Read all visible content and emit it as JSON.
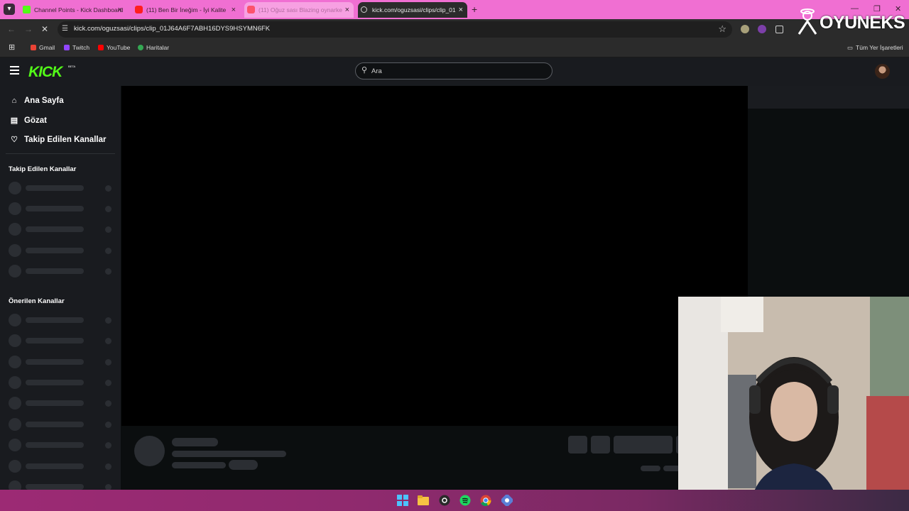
{
  "browser": {
    "tabs": [
      {
        "title": "Channel Points - Kick Dashboard",
        "favicon": "kick-favicon-icon",
        "state": "normal"
      },
      {
        "title": "(11) Ben Bir İneğim - İyi Kalite",
        "favicon": "youtube-favicon-icon",
        "state": "normal"
      },
      {
        "title": "(11) Oğuz sası Blazing oynarke",
        "favicon": "youtube-favicon-icon",
        "state": "hover"
      },
      {
        "title": "kick.com/oguzsasi/clips/clip_01",
        "favicon": "loading-icon",
        "state": "active"
      }
    ],
    "url": "kick.com/oguzsasi/clips/clip_01J64A6F7ABH16DYS9HSYMN6FK",
    "bookmarks": [
      "Gmail",
      "Twitch",
      "YouTube",
      "Haritalar"
    ],
    "all_bookmarks_label": "Tüm Yer İşaretleri",
    "colors": {
      "tab_strip": "#f06fd2",
      "chrome": "#2b2b2b"
    }
  },
  "overlay": {
    "brand": "OYUNEKS"
  },
  "kick": {
    "logo": "KICK",
    "beta_label": "BETA",
    "search_placeholder": "Ara",
    "accent": "#53fc18",
    "nav": [
      {
        "label": "Ana Sayfa",
        "icon": "home-icon"
      },
      {
        "label": "Gözat",
        "icon": "browse-icon"
      },
      {
        "label": "Takip Edilen Kanallar",
        "icon": "heart-icon"
      }
    ],
    "followed_title": "Takip Edilen Kanallar",
    "recommended_title": "Önerilen Kanallar"
  }
}
